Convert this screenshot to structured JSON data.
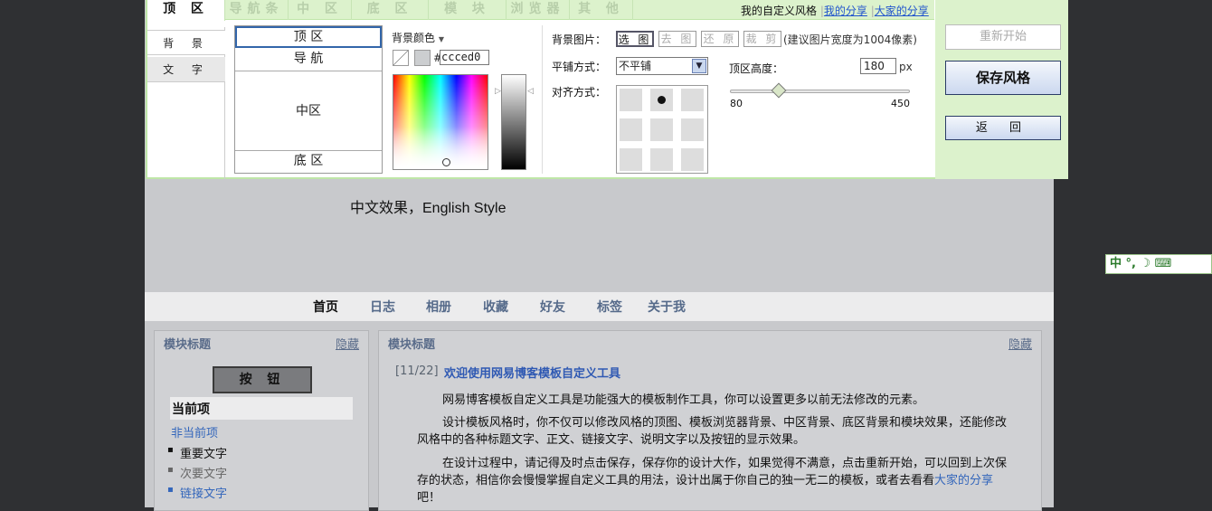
{
  "blog": {
    "subtitle": "中文效果，English Style",
    "nav": [
      "首页",
      "日志",
      "相册",
      "收藏",
      "好友",
      "标签",
      "关于我"
    ],
    "left_module": {
      "title": "模块标题",
      "hide": "隐藏",
      "button": "按 钮",
      "current_item": "当前项",
      "non_current_item": "非当前项",
      "important_text": "重要文字",
      "secondary_text": "次要文字",
      "link_text": "链接文字"
    },
    "main_module": {
      "title": "模块标题",
      "hide": "隐藏",
      "post_date": "[11/22]",
      "post_title": "欢迎使用网易博客模板自定义工具",
      "para1": "网易博客模板自定义工具是功能强大的模板制作工具，你可以设置更多以前无法修改的元素。",
      "para2": "设计模板风格时，你不仅可以修改风格的顶图、模板浏览器背景、中区背景、底区背景和模块效果，还能修改风格中的各种标题文字、正文、链接文字、说明文字以及按钮的显示效果。",
      "para3_a": "在设计过程中，请记得及时点击保存，保存你的设计大作，如果觉得不满意，点击重新开始，可以回到上次保存的状态，相信你会慢慢掌握自定义工具的用法，设计出属于你自己的独一无二的模板，或者去看看",
      "para3_link": "大家的分享",
      "para3_b": "吧！"
    }
  },
  "editor": {
    "tabs": [
      "顶 区",
      "导航条",
      "中 区",
      "底 区",
      "模 块",
      "浏览器",
      "其 他"
    ],
    "my_style": "我的自定义风格",
    "sep": "|",
    "my_share": "我的分享",
    "all_share": "大家的分享",
    "side_tabs": [
      "背 景",
      "文 字"
    ],
    "sections": [
      "顶 区",
      "导 航",
      "中区",
      "底 区"
    ],
    "bg_color_label": "背景颜色",
    "hex_prefix": "#",
    "hex_value": "ccced0",
    "color_current": "#ccced0",
    "bg_image_label": "背景图片：",
    "btn_select": "选 图",
    "btn_remove": "去 图",
    "btn_restore": "还 原",
    "btn_crop": "裁 剪",
    "hint": "(建议图片宽度为1004像素)",
    "tile_label": "平铺方式：",
    "tile_value": "不平铺",
    "align_label": "对齐方式：",
    "height_label": "顶区高度：",
    "height_value": "180",
    "height_unit": "px",
    "slider_min": "80",
    "slider_max": "450",
    "slider_value": 180,
    "restart": "重新开始",
    "save": "保存风格",
    "back": "返 回"
  },
  "ime": {
    "text": "中 °, ☽ ⌨"
  }
}
